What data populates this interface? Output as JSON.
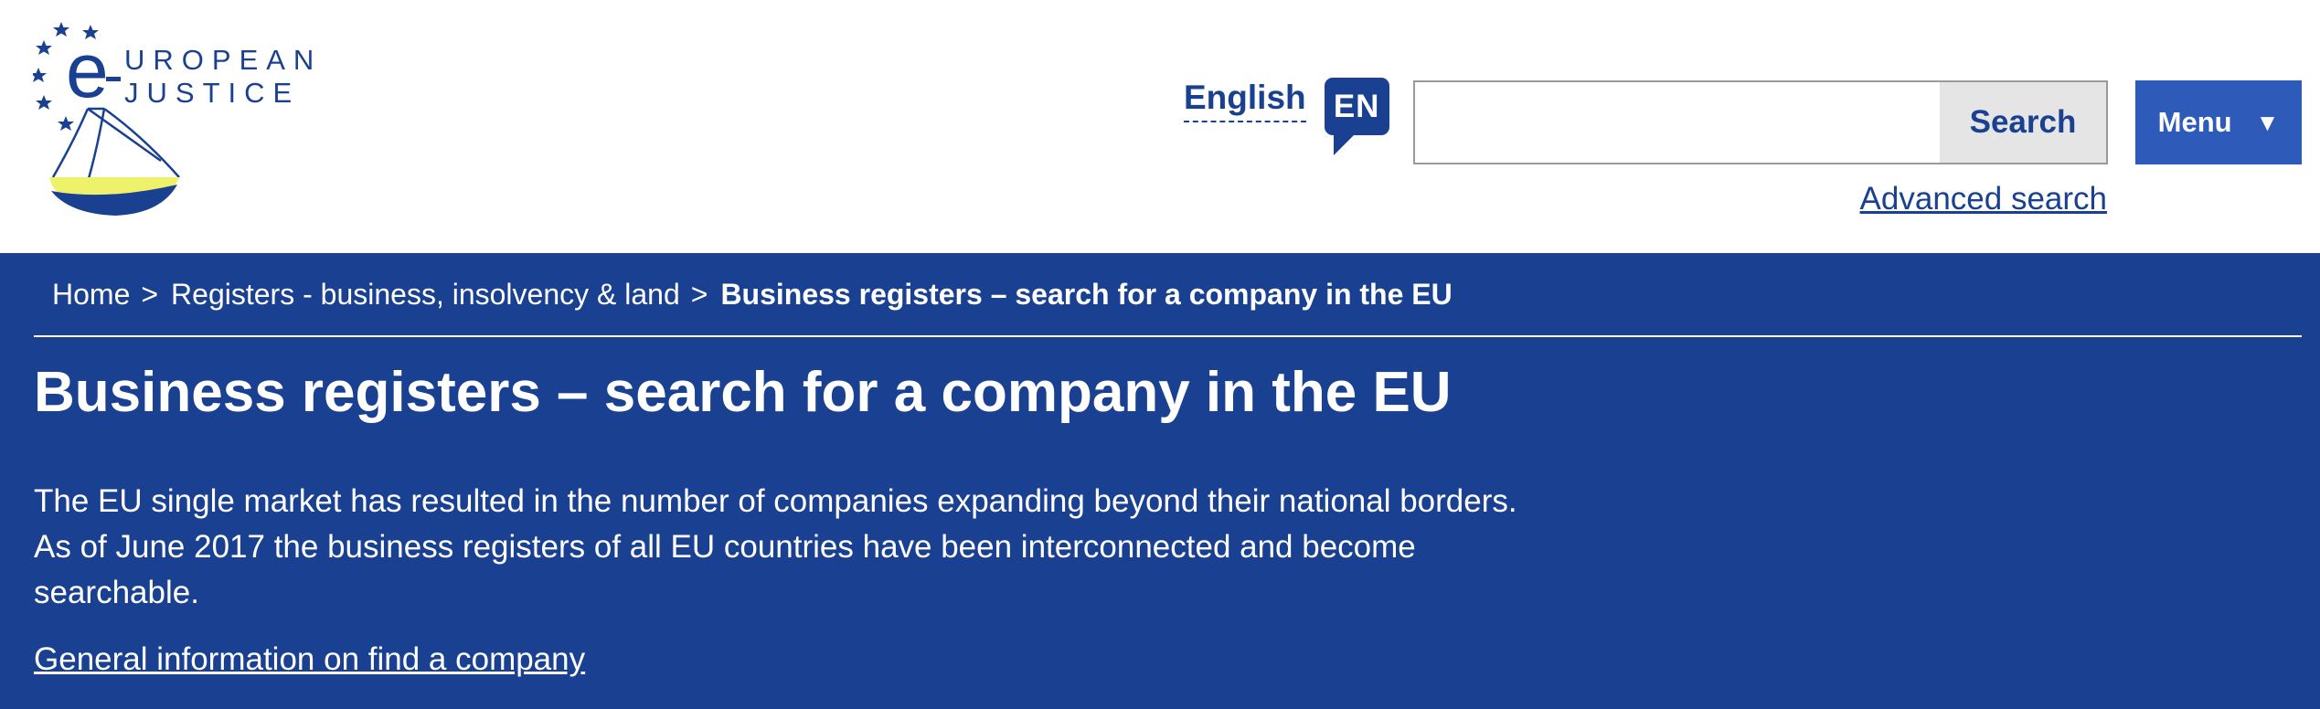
{
  "header": {
    "logo_line1": "UROPEAN",
    "logo_line2": "JUSTICE",
    "language": {
      "label": "English",
      "code": "EN"
    },
    "search": {
      "placeholder": "",
      "value": "",
      "button_label": "Search"
    },
    "menu_label": "Menu",
    "menu_arrow": "▼",
    "advanced_search_label": "Advanced search"
  },
  "breadcrumb": {
    "items": [
      "Home",
      "Registers - business, insolvency & land",
      "Business registers – search for a company in the EU"
    ],
    "separator": ">"
  },
  "main": {
    "title": "Business registers – search for a company in the EU",
    "intro": "The EU single market has resulted in the number of companies expanding beyond their national borders. As of June 2017 the business registers of all EU countries have been interconnected and become searchable.",
    "info_link": "General information on find a company"
  },
  "colors": {
    "brand_blue": "#1a4191",
    "menu_blue": "#2e5bba",
    "logo_yellow": "#eef26a",
    "search_button_bg": "#e5e5e5"
  },
  "icons": {
    "menu": "triangle-down-icon",
    "logo": "e-justice-logo"
  }
}
